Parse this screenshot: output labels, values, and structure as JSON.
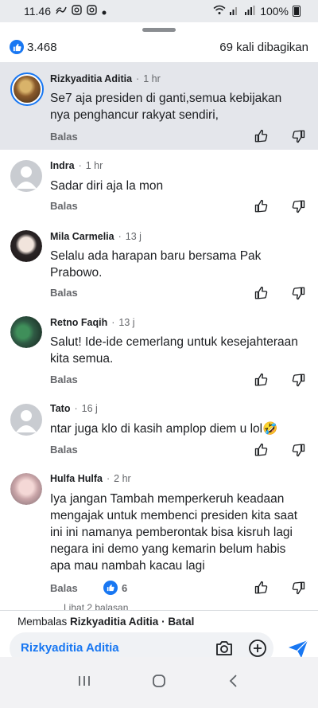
{
  "status_bar": {
    "time": "11.46",
    "icons_left": [
      "signal-wave-icon",
      "instagram-icon",
      "instagram-icon",
      "dot-icon"
    ],
    "battery": "100%"
  },
  "summary": {
    "like_count": "3.468",
    "shares": "69 kali dibagikan"
  },
  "comments": [
    {
      "name": "Rizkyaditia Aditia",
      "time": "1 hr",
      "text": "Se7 aja presiden di ganti,semua kebijakan nya penghancur rakyat sendiri,",
      "reply_label": "Balas",
      "highlighted": true
    },
    {
      "name": "Indra",
      "time": "1 hr",
      "text": "Sadar diri aja la mon",
      "reply_label": "Balas"
    },
    {
      "name": "Mila Carmelia",
      "time": "13 j",
      "text": "Selalu ada harapan baru bersama Pak Prabowo.",
      "reply_label": "Balas"
    },
    {
      "name": "Retno Faqih",
      "time": "13 j",
      "text": "Salut! Ide-ide cemerlang untuk kesejahteraan kita semua.",
      "reply_label": "Balas"
    },
    {
      "name": "Tato",
      "time": "16 j",
      "text": "ntar juga klo di kasih amplop diem u lol🤣",
      "reply_label": "Balas"
    },
    {
      "name": "Hulfa Hulfa",
      "time": "2 hr",
      "text": "Iya jangan Tambah memperkeruh keadaan mengajak untuk membenci presiden kita saat ini ini namanya pemberontak bisa kisruh lagi negara ini demo yang kemarin belum habis apa mau nambah kacau lagi",
      "reply_label": "Balas",
      "reaction_count": "6"
    }
  ],
  "more_replies": "Lihat 2 balasan",
  "reply_bar": {
    "prefix": "Membalas ",
    "target": "Rizkyaditia Aditia",
    "separator": " · ",
    "cancel": "Batal",
    "input_value": "Rizkyaditia Aditia"
  },
  "colors": {
    "accent": "#1877f2",
    "highlight_bg": "#e4e6eb",
    "muted_text": "#65676b"
  }
}
